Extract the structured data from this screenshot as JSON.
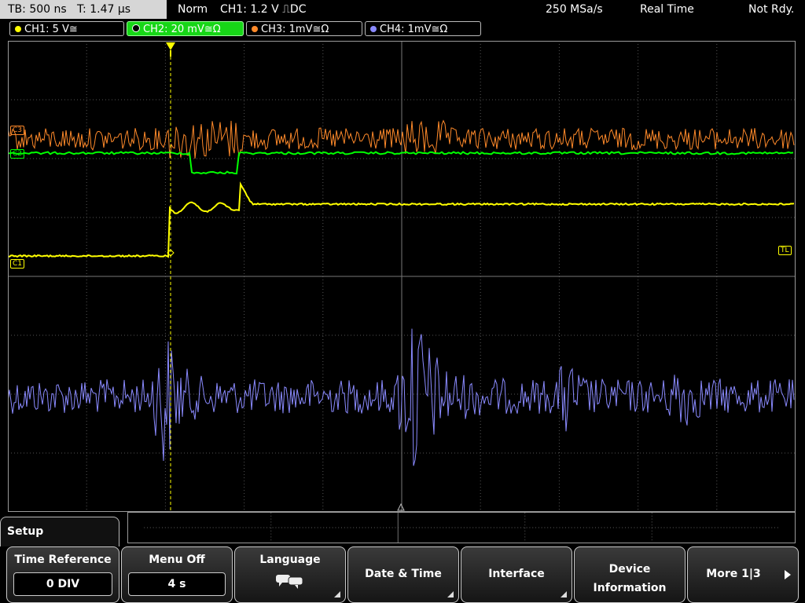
{
  "status": {
    "timebase": "TB: 500 ns",
    "trigger_time": "T: 1.47 µs",
    "mode": "Norm",
    "trigger_info": "CH1: 1.2 V ⎍DC",
    "sample_rate": "250 MSa/s",
    "acq_mode": "Real Time",
    "ready": "Not Rdy."
  },
  "channels": [
    {
      "label": "CH1: 5 V≅",
      "color": "#ffff00"
    },
    {
      "label": "CH2: 20 mV≅Ω",
      "color": "#00ff00"
    },
    {
      "label": "CH3: 1mV≅Ω",
      "color": "#ff8a2a"
    },
    {
      "label": "CH4: 1mV≅Ω",
      "color": "#8a8aff"
    }
  ],
  "markers": {
    "c1": "C1",
    "c2": "C2",
    "c3": "C3",
    "tl": "TL"
  },
  "menu": {
    "title": "Setup",
    "time_reference": {
      "title": "Time Reference",
      "value": "0 DIV"
    },
    "menu_off": {
      "title": "Menu Off",
      "value": "4 s"
    },
    "language": {
      "title": "Language"
    },
    "date_time": "Date & Time",
    "interface": "Interface",
    "device_info_1": "Device",
    "device_info_2": "Information",
    "more": "More 1|3"
  },
  "colors": {
    "ch1": "#ffff00",
    "ch2": "#00ff00",
    "ch3": "#ff8a2a",
    "ch4": "#8a8aff"
  }
}
